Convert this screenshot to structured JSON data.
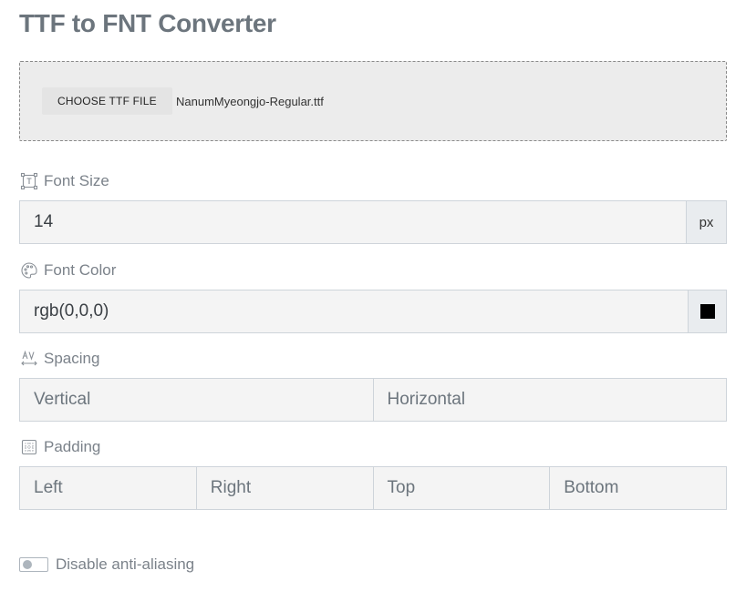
{
  "page": {
    "title": "TTF to FNT Converter"
  },
  "file": {
    "button_label": "CHOOSE TTF FILE",
    "file_name": "NanumMyeongjo-Regular.ttf"
  },
  "font_size": {
    "label": "Font Size",
    "icon": "resize-icon",
    "value": "14",
    "unit": "px"
  },
  "font_color": {
    "label": "Font Color",
    "icon": "palette-icon",
    "value": "rgb(0,0,0)",
    "swatch_color": "#000000"
  },
  "spacing": {
    "label": "Spacing",
    "icon": "letter-spacing-icon",
    "vertical_placeholder": "Vertical",
    "horizontal_placeholder": "Horizontal"
  },
  "padding": {
    "label": "Padding",
    "icon": "padding-icon",
    "left_placeholder": "Left",
    "right_placeholder": "Right",
    "top_placeholder": "Top",
    "bottom_placeholder": "Bottom"
  },
  "anti_aliasing": {
    "label": "Disable anti-aliasing",
    "enabled": false
  }
}
